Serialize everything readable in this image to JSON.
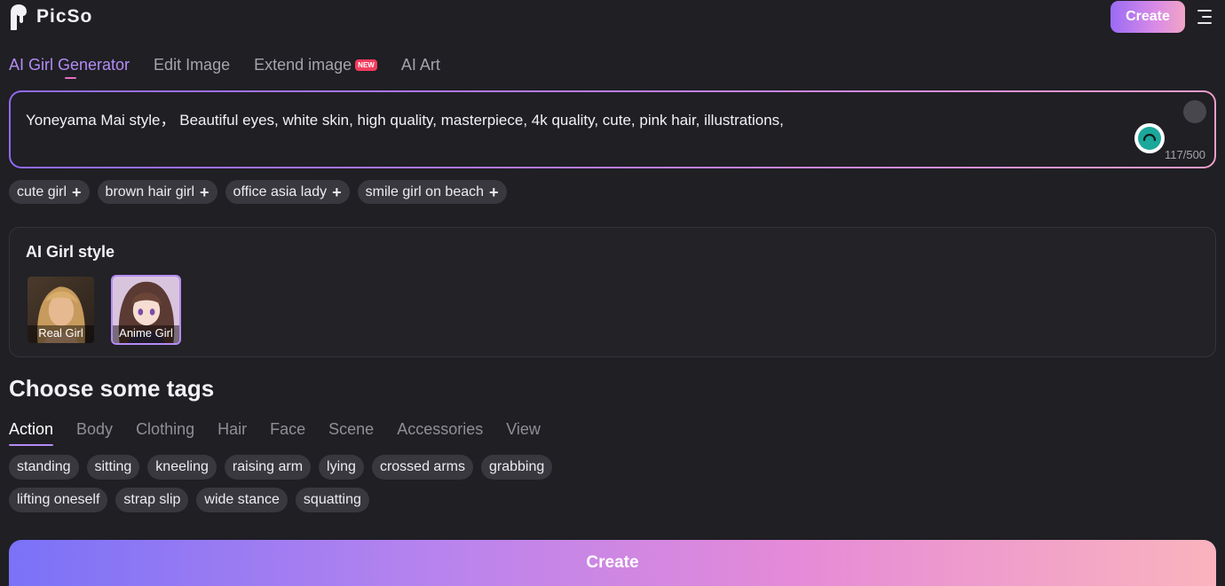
{
  "header": {
    "logo_text": "PicSo",
    "create_label": "Create",
    "menu_icon": "hamburger-menu-icon"
  },
  "main_tabs": [
    {
      "label": "AI Girl Generator",
      "active": true
    },
    {
      "label": "Edit Image",
      "active": false
    },
    {
      "label": "Extend image",
      "active": false,
      "badge": "NEW"
    },
    {
      "label": "AI Art",
      "active": false
    }
  ],
  "prompt": {
    "value": "Yoneyama Mai style，  Beautiful eyes, white skin, high quality, masterpiece, 4k quality, cute, pink hair, illustrations,",
    "char_count": "117/500"
  },
  "suggestions": [
    {
      "label": "cute girl",
      "icon": "plus-icon"
    },
    {
      "label": "brown hair girl",
      "icon": "plus-icon"
    },
    {
      "label": "office asia lady",
      "icon": "plus-icon"
    },
    {
      "label": "smile girl on beach",
      "icon": "plus-icon"
    }
  ],
  "style_panel": {
    "title": "AI Girl style",
    "options": [
      {
        "label": "Real Girl",
        "selected": false
      },
      {
        "label": "Anime Girl",
        "selected": true
      }
    ]
  },
  "tags": {
    "title": "Choose some tags",
    "tabs": [
      {
        "label": "Action",
        "active": true
      },
      {
        "label": "Body",
        "active": false
      },
      {
        "label": "Clothing",
        "active": false
      },
      {
        "label": "Hair",
        "active": false
      },
      {
        "label": "Face",
        "active": false
      },
      {
        "label": "Scene",
        "active": false
      },
      {
        "label": "Accessories",
        "active": false
      },
      {
        "label": "View",
        "active": false
      }
    ],
    "items": [
      "standing",
      "sitting",
      "kneeling",
      "raising arm",
      "lying",
      "crossed arms",
      "grabbing",
      "lifting oneself",
      "strap slip",
      "wide stance",
      "squatting"
    ]
  },
  "bottom_create_label": "Create",
  "colors": {
    "background": "#1f1f24",
    "accent_purple": "#b48cf5",
    "chip_bg": "#38383e",
    "badge_red": "#f33c5d"
  }
}
